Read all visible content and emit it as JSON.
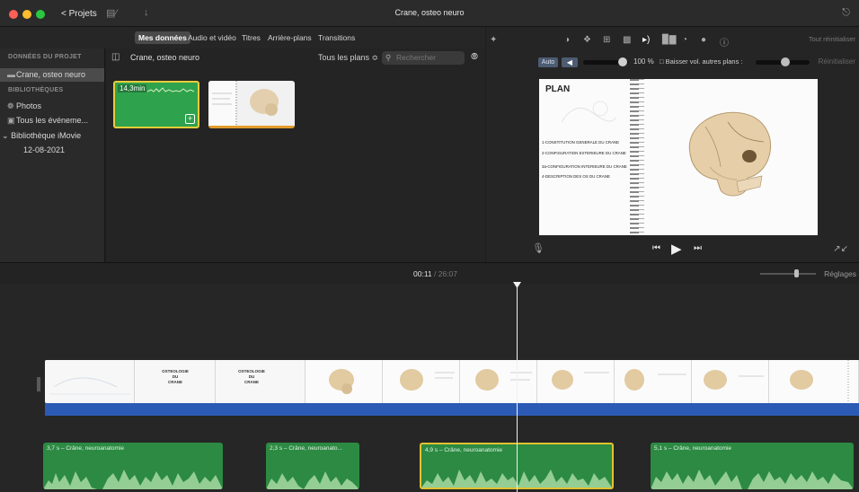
{
  "titlebar": {
    "projects_label": "< Projets",
    "window_title": "Crane, osteo neuro"
  },
  "browser_tabs": [
    {
      "label": "Mes données",
      "active": true
    },
    {
      "label": "Audio et vidéo",
      "active": false
    },
    {
      "label": "Titres",
      "active": false
    },
    {
      "label": "Arrière-plans",
      "active": false
    },
    {
      "label": "Transitions",
      "active": false
    }
  ],
  "sidebar": {
    "project_heading": "DONNÉES DU PROJET",
    "project_item": "Crane, osteo neuro",
    "libraries_heading": "BIBLIOTHÈQUES",
    "items": [
      {
        "label": "Photos",
        "icon": "gear-icon"
      },
      {
        "label": "Tous les événeme...",
        "icon": "event-icon"
      }
    ],
    "library": "Bibliothèque iMovie",
    "event": "12-08-2021"
  },
  "browser": {
    "title": "Crane, osteo neuro",
    "filter": "Tous les plans ≎",
    "search_placeholder": "Rechercher",
    "clip1_duration": "14,3min"
  },
  "viewer": {
    "reset_all": "Tout réinitialiser",
    "auto_label": "Auto",
    "volume_pct": "100  %",
    "lower_others": "Baisser vol. autres plans :",
    "reset": "Réinitialiser",
    "preview": {
      "plan_title": "PLAN",
      "lines": [
        "1-CONSTITUTION GENERALE DU CRANE",
        "2-CONFIGURATION EXTERIEURE DU CRANE",
        "3a-CONFIGURATION INTERIEURE DU CRANE",
        "4-DESCRIPTION DES OS DU CRANE"
      ]
    }
  },
  "timeline": {
    "current_time": "00:11",
    "total_time": "/ 26:07",
    "settings_label": "Réglages",
    "title_card_text": "OSTEOLOGIE\nDU\nCRANE",
    "audio_clips": [
      {
        "label": "3,7 s – Crâne, neuroanatomie",
        "selected": false
      },
      {
        "label": "2,3 s – Crâne, neuroanato...",
        "selected": false
      },
      {
        "label": "4,9 s – Crâne, neuroanatomie",
        "selected": true
      },
      {
        "label": "5,1 s – Crâne, neuroanatomie",
        "selected": false
      }
    ]
  },
  "colors": {
    "accent_blue": "#2c5bb5",
    "audio_green": "#2c8a43",
    "selection_yellow": "#e2c22f"
  }
}
